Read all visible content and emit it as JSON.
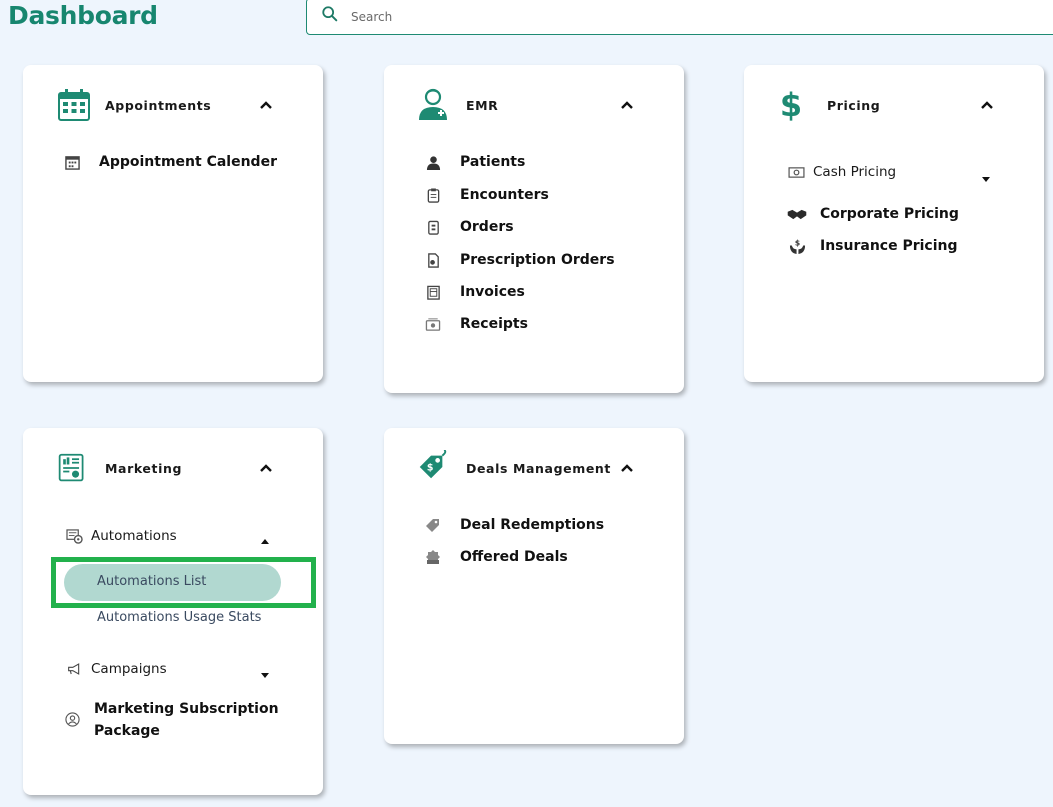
{
  "page": {
    "title": "Dashboard"
  },
  "search": {
    "placeholder": "Search",
    "value": ""
  },
  "colors": {
    "brand": "#17866f",
    "highlight": "#22b14c",
    "active_pill": "#b1d8d0",
    "background": "#eef5fd"
  },
  "cards": {
    "appointments": {
      "title": "Appointments",
      "icon": "calendar-icon",
      "items": [
        {
          "label": "Appointment Calender",
          "icon": "calendar-grid-icon"
        }
      ]
    },
    "emr": {
      "title": "EMR",
      "icon": "doctor-icon",
      "items": [
        {
          "label": "Patients",
          "icon": "patient-icon"
        },
        {
          "label": "Encounters",
          "icon": "clipboard-icon"
        },
        {
          "label": "Orders",
          "icon": "order-icon"
        },
        {
          "label": "Prescription Orders",
          "icon": "prescription-icon"
        },
        {
          "label": "Invoices",
          "icon": "invoice-icon"
        },
        {
          "label": "Receipts",
          "icon": "receipt-icon"
        }
      ]
    },
    "pricing": {
      "title": "Pricing",
      "icon": "dollar-icon",
      "cash": {
        "label": "Cash Pricing",
        "icon": "cash-icon"
      },
      "items": [
        {
          "label": "Corporate Pricing",
          "icon": "handshake-icon"
        },
        {
          "label": "Insurance Pricing",
          "icon": "insurance-hands-icon"
        }
      ]
    },
    "marketing": {
      "title": "Marketing",
      "icon": "report-icon",
      "automations": {
        "label": "Automations",
        "icon": "automation-icon",
        "items": [
          {
            "label": "Automations List"
          },
          {
            "label": "Automations Usage Stats"
          }
        ]
      },
      "campaigns": {
        "label": "Campaigns",
        "icon": "megaphone-icon"
      },
      "subscription": {
        "line1": "Marketing Subscription",
        "line2": "Package",
        "icon": "user-circle-icon"
      }
    },
    "deals": {
      "title": "Deals Management",
      "icon": "tag-icon",
      "items": [
        {
          "label": "Deal Redemptions",
          "icon": "tag-small-icon"
        },
        {
          "label": "Offered Deals",
          "icon": "badge-icon"
        }
      ]
    }
  }
}
